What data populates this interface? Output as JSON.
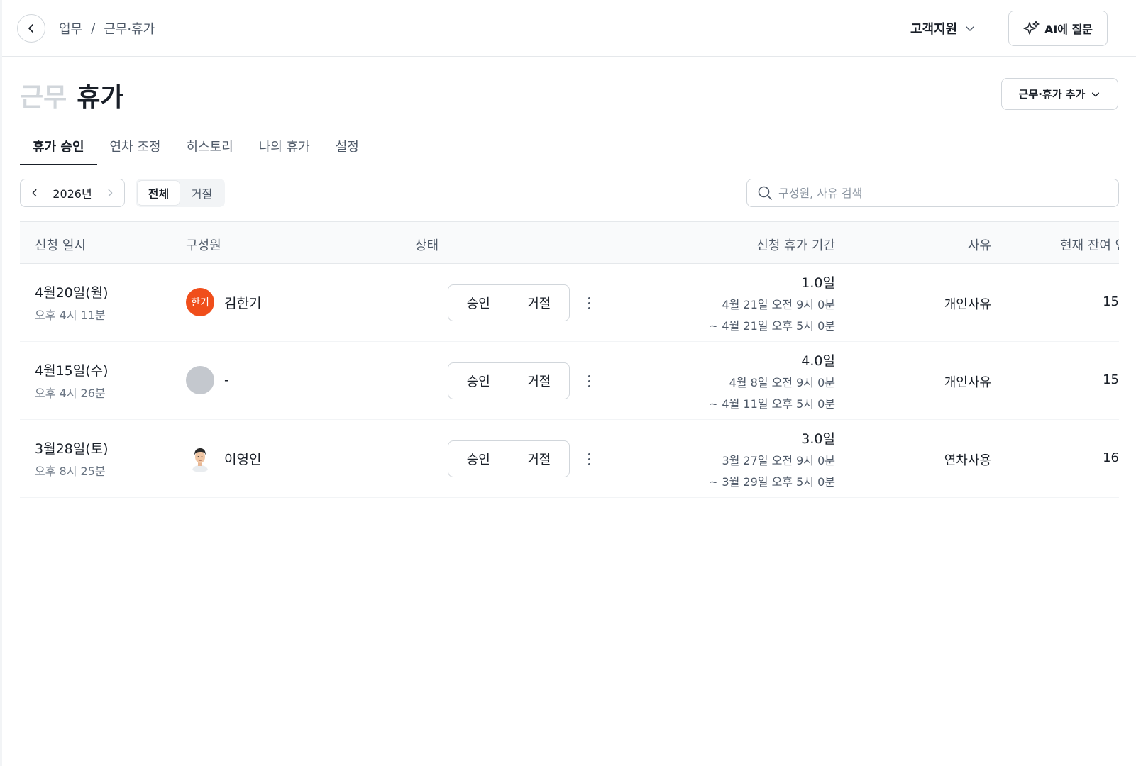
{
  "breadcrumb": {
    "root": "업무",
    "separator": "/",
    "current": "근무·휴가"
  },
  "header": {
    "org_name": "고객지원",
    "ai_button": "AI에 질문"
  },
  "page": {
    "title_muted": "근무",
    "title_main": "휴가",
    "add_button": "근무·휴가 추가"
  },
  "tabs": [
    "휴가 승인",
    "연차 조정",
    "히스토리",
    "나의 휴가",
    "설정"
  ],
  "filters": {
    "year": "2026년",
    "segments": [
      "전체",
      "거절"
    ],
    "search_placeholder": "구성원, 사유 검색"
  },
  "table": {
    "columns": [
      "신청 일시",
      "구성원",
      "상태",
      "신청 휴가 기간",
      "사유",
      "현재 잔여 연차"
    ],
    "actions": {
      "approve": "승인",
      "reject": "거절"
    },
    "rows": [
      {
        "date": "4월20일(월)",
        "time": "오후 4시 11분",
        "member": "김한기",
        "avatar_text": "한기",
        "avatar_color": "#f04e1b",
        "days": "1.0일",
        "range_start": "4월 21일 오전 9시 0분",
        "range_end": "~ 4월 21일 오후 5시 0분",
        "reason": "개인사유",
        "remaining": "15"
      },
      {
        "date": "4월15일(수)",
        "time": "오후 4시 26분",
        "member": "-",
        "avatar_text": "",
        "avatar_color": "#c4c8ce",
        "days": "4.0일",
        "range_start": "4월 8일 오전 9시 0분",
        "range_end": "~ 4월 11일 오후 5시 0분",
        "reason": "개인사유",
        "remaining": "15"
      },
      {
        "date": "3월28일(토)",
        "time": "오후 8시 25분",
        "member": "이영인",
        "avatar_text": "",
        "avatar_color": "#ffffff",
        "days": "3.0일",
        "range_start": "3월 27일 오전 9시 0분",
        "range_end": "~ 3월 29일 오후 5시 0분",
        "reason": "연차사용",
        "remaining": "16"
      }
    ]
  }
}
